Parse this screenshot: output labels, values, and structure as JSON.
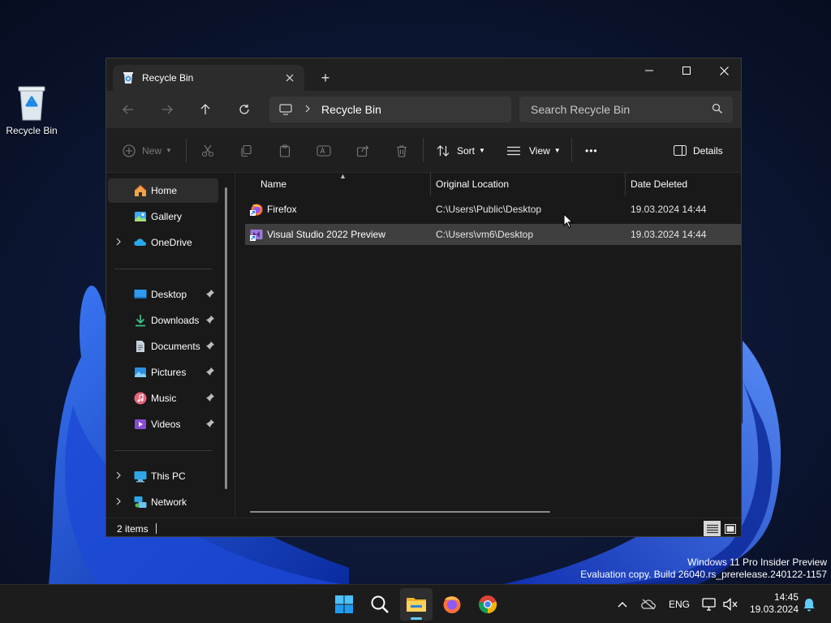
{
  "desktop": {
    "icons": [
      {
        "label": "Recycle Bin",
        "icon": "recycle-bin-icon"
      }
    ],
    "watermark": {
      "line1": "Windows 11 Pro Insider Preview",
      "line2": "Evaluation copy. Build 26040.rs_prerelease.240122-1157"
    }
  },
  "window": {
    "tab_title": "Recycle Bin",
    "new_tab": "+",
    "address": {
      "crumb": "Recycle Bin"
    },
    "search": {
      "placeholder": "Search Recycle Bin"
    },
    "toolbar": {
      "new_label": "New",
      "sort_label": "Sort",
      "view_label": "View",
      "more_label": "•••",
      "details_label": "Details"
    },
    "nav": {
      "top": [
        {
          "label": "Home",
          "icon": "home-icon",
          "selected": true
        },
        {
          "label": "Gallery",
          "icon": "gallery-icon"
        },
        {
          "label": "OneDrive",
          "icon": "onedrive-icon",
          "expandable": true
        }
      ],
      "quick_access": [
        {
          "label": "Desktop",
          "icon": "desktop-icon",
          "pinned": true
        },
        {
          "label": "Downloads",
          "icon": "downloads-icon",
          "pinned": true
        },
        {
          "label": "Documents",
          "icon": "documents-icon",
          "pinned": true
        },
        {
          "label": "Pictures",
          "icon": "pictures-icon",
          "pinned": true
        },
        {
          "label": "Music",
          "icon": "music-icon",
          "pinned": true
        },
        {
          "label": "Videos",
          "icon": "videos-icon",
          "pinned": true
        }
      ],
      "bottom": [
        {
          "label": "This PC",
          "icon": "this-pc-icon",
          "expandable": true
        },
        {
          "label": "Network",
          "icon": "network-icon",
          "expandable": true
        }
      ]
    },
    "columns": {
      "name": "Name",
      "original_location": "Original Location",
      "date_deleted": "Date Deleted"
    },
    "files": [
      {
        "name": "Firefox",
        "location": "C:\\Users\\Public\\Desktop",
        "date": "19.03.2024 14:44",
        "icon": "firefox-shortcut-icon",
        "selected": false
      },
      {
        "name": "Visual Studio 2022 Preview",
        "location": "C:\\Users\\vm6\\Desktop",
        "date": "19.03.2024 14:44",
        "icon": "visual-studio-shortcut-icon",
        "selected": true
      }
    ],
    "status": {
      "item_count": "2 items"
    }
  },
  "taskbar": {
    "apps": [
      "start-icon",
      "search-icon",
      "file-explorer-icon",
      "firefox-icon",
      "chrome-icon"
    ],
    "active_app": "file-explorer-icon",
    "tray": {
      "language": "ENG",
      "time": "14:45",
      "date": "19.03.2024"
    }
  },
  "colors": {
    "accent": "#60cdff",
    "window_bg": "#191919",
    "selected_row": "#3f3f3f"
  }
}
